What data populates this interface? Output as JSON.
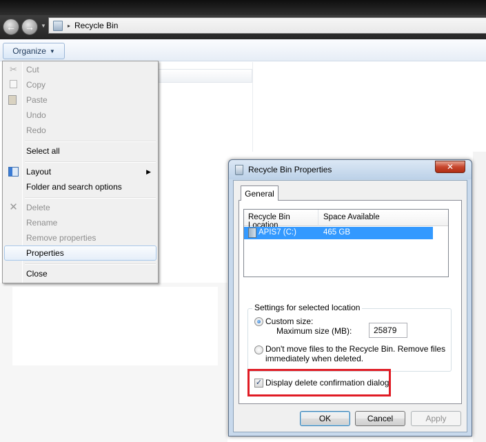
{
  "window": {
    "address_label": "Recycle Bin",
    "address_separator": "▸"
  },
  "toolbar": {
    "organize_label": "Organize"
  },
  "organize_menu": {
    "items": [
      {
        "label": "Cut",
        "enabled": false,
        "icon": "cut-icon"
      },
      {
        "label": "Copy",
        "enabled": false,
        "icon": "copy-icon"
      },
      {
        "label": "Paste",
        "enabled": false,
        "icon": "paste-icon"
      },
      {
        "label": "Undo",
        "enabled": false
      },
      {
        "label": "Redo",
        "enabled": false
      },
      {
        "label": "Select all",
        "enabled": true
      },
      {
        "label": "Layout",
        "enabled": true,
        "icon": "layout-icon",
        "submenu": true
      },
      {
        "label": "Folder and search options",
        "enabled": true
      },
      {
        "label": "Delete",
        "enabled": false,
        "icon": "delete-icon"
      },
      {
        "label": "Rename",
        "enabled": false
      },
      {
        "label": "Remove properties",
        "enabled": false
      },
      {
        "label": "Properties",
        "enabled": true,
        "highlighted": true
      },
      {
        "label": "Close",
        "enabled": true
      }
    ]
  },
  "dialog": {
    "title": "Recycle Bin Properties",
    "close_glyph": "✕",
    "tab": "General",
    "columns": [
      "Recycle Bin Location",
      "Space Available"
    ],
    "locations": [
      {
        "location": "APIS7 (C:)",
        "space": "465 GB",
        "selected": true
      }
    ],
    "group_title": "Settings for selected location",
    "custom_size_label": "Custom size:",
    "max_size_label": "Maximum size (MB):",
    "max_size_value": "25879",
    "dont_move_line1": "Don't move files to the Recycle Bin. Remove files",
    "dont_move_line2": "immediately when deleted.",
    "confirm_label": "Display delete confirmation dialog",
    "confirm_checked": true,
    "custom_size_selected": true,
    "ok_label": "OK",
    "cancel_label": "Cancel",
    "apply_label": "Apply",
    "apply_enabled": false
  },
  "colors": {
    "selection": "#3399ff",
    "highlight_box": "#e01b24",
    "close_button": "#c7472e"
  }
}
